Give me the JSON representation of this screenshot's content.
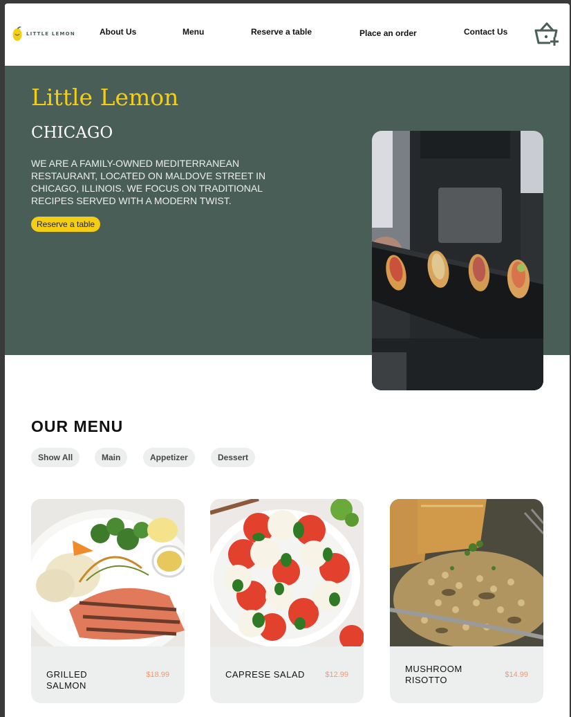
{
  "brand": {
    "logo_text": "LITTLE LEMON"
  },
  "nav": {
    "items": [
      "About Us",
      "Menu",
      "Reserve a table",
      "Place an order",
      "Contact Us"
    ],
    "cart_icon": "basket-plus-icon"
  },
  "hero": {
    "title": "Little Lemon",
    "subtitle": "CHICAGO",
    "description": "We are a family-owned Mediterranean restaurant, located on Maldove Street in Chicago, Illinois. We focus on traditional recipes served with a modern twist.",
    "button_label": "Reserve a table"
  },
  "menu": {
    "title": "OUR MENU",
    "filters": [
      "Show All",
      "Main",
      "Appetizer",
      "Dessert"
    ],
    "items": [
      {
        "name": "GRILLED SALMON",
        "price": "$18.99"
      },
      {
        "name": "CAPRESE SALAD",
        "price": "$12.99"
      },
      {
        "name": "MUSHROOM RISOTTO",
        "price": "$14.99"
      }
    ]
  },
  "colors": {
    "primary_green": "#495e57",
    "primary_yellow": "#f4ce14",
    "price_orange": "#ee9972",
    "chip_gray": "#edefee"
  }
}
